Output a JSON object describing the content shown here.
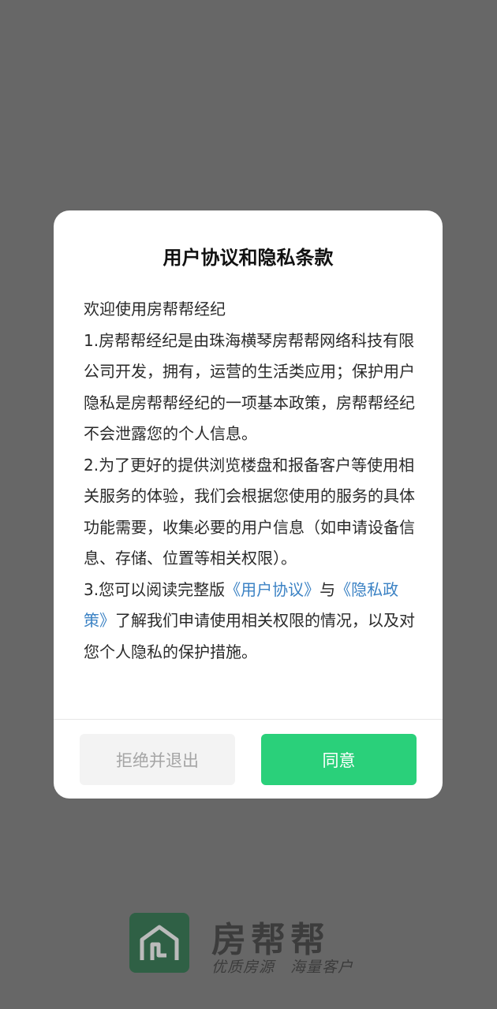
{
  "dialog": {
    "title": "用户协议和隐私条款",
    "greeting": "欢迎使用房帮帮经纪",
    "item1": "1.房帮帮经纪是由珠海横琴房帮帮网络科技有限公司开发，拥有，运营的生活类应用；保护用户隐私是房帮帮经纪的一项基本政策，房帮帮经纪不会泄露您的个人信息。",
    "item2": "2.为了更好的提供浏览楼盘和报备客户等使用相关服务的体验，我们会根据您使用的服务的具体功能需要，收集必要的用户信息（如申请设备信息、存储、位置等相关权限）。",
    "item3_prefix": "3.您可以阅读完整版",
    "user_agreement_link": "《用户协议》",
    "and": "与",
    "privacy_policy_link": "《隐私政策》",
    "item3_suffix": "了解我们申请使用相关权限的情况，以及对您个人隐私的保护措施。",
    "reject_label": "拒绝并退出",
    "agree_label": "同意"
  },
  "brand": {
    "name": "房帮帮",
    "slogan": "优质房源　海量客户",
    "logo_icon": "house-logo-icon"
  },
  "colors": {
    "overlay": "#676767",
    "agree_button": "#2ad07a",
    "link": "#3b82c4",
    "reject_button": "#f3f3f3"
  }
}
